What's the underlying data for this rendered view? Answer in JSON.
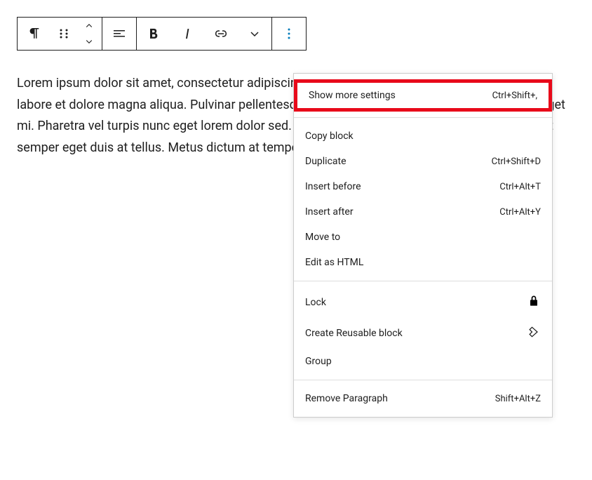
{
  "content": {
    "text": "Lorem ipsum dolor sit amet, consectetur adipiscing elit, sed do eiusmod tempor incididunt ut labore et dolore magna aliqua. Pulvinar pellentesque habitant morbi tristique. Arcu dui sapien eget mi. Pharetra vel turpis nunc eget lorem dolor sed. Mauris cursus mattis molestie a iaculis at erat semper eget duis at tellus. Metus dictum at tempor commodo ullamcorper a lacus."
  },
  "menu": {
    "section1": [
      {
        "label": "Show more settings",
        "shortcut": "Ctrl+Shift+,",
        "highlighted": true
      }
    ],
    "section2": [
      {
        "label": "Copy block",
        "shortcut": ""
      },
      {
        "label": "Duplicate",
        "shortcut": "Ctrl+Shift+D"
      },
      {
        "label": "Insert before",
        "shortcut": "Ctrl+Alt+T"
      },
      {
        "label": "Insert after",
        "shortcut": "Ctrl+Alt+Y"
      },
      {
        "label": "Move to",
        "shortcut": ""
      },
      {
        "label": "Edit as HTML",
        "shortcut": ""
      }
    ],
    "section3": [
      {
        "label": "Lock",
        "icon": "lock"
      },
      {
        "label": "Create Reusable block",
        "icon": "diamond"
      },
      {
        "label": "Group",
        "shortcut": ""
      }
    ],
    "section4": [
      {
        "label": "Remove Paragraph",
        "shortcut": "Shift+Alt+Z"
      }
    ]
  }
}
